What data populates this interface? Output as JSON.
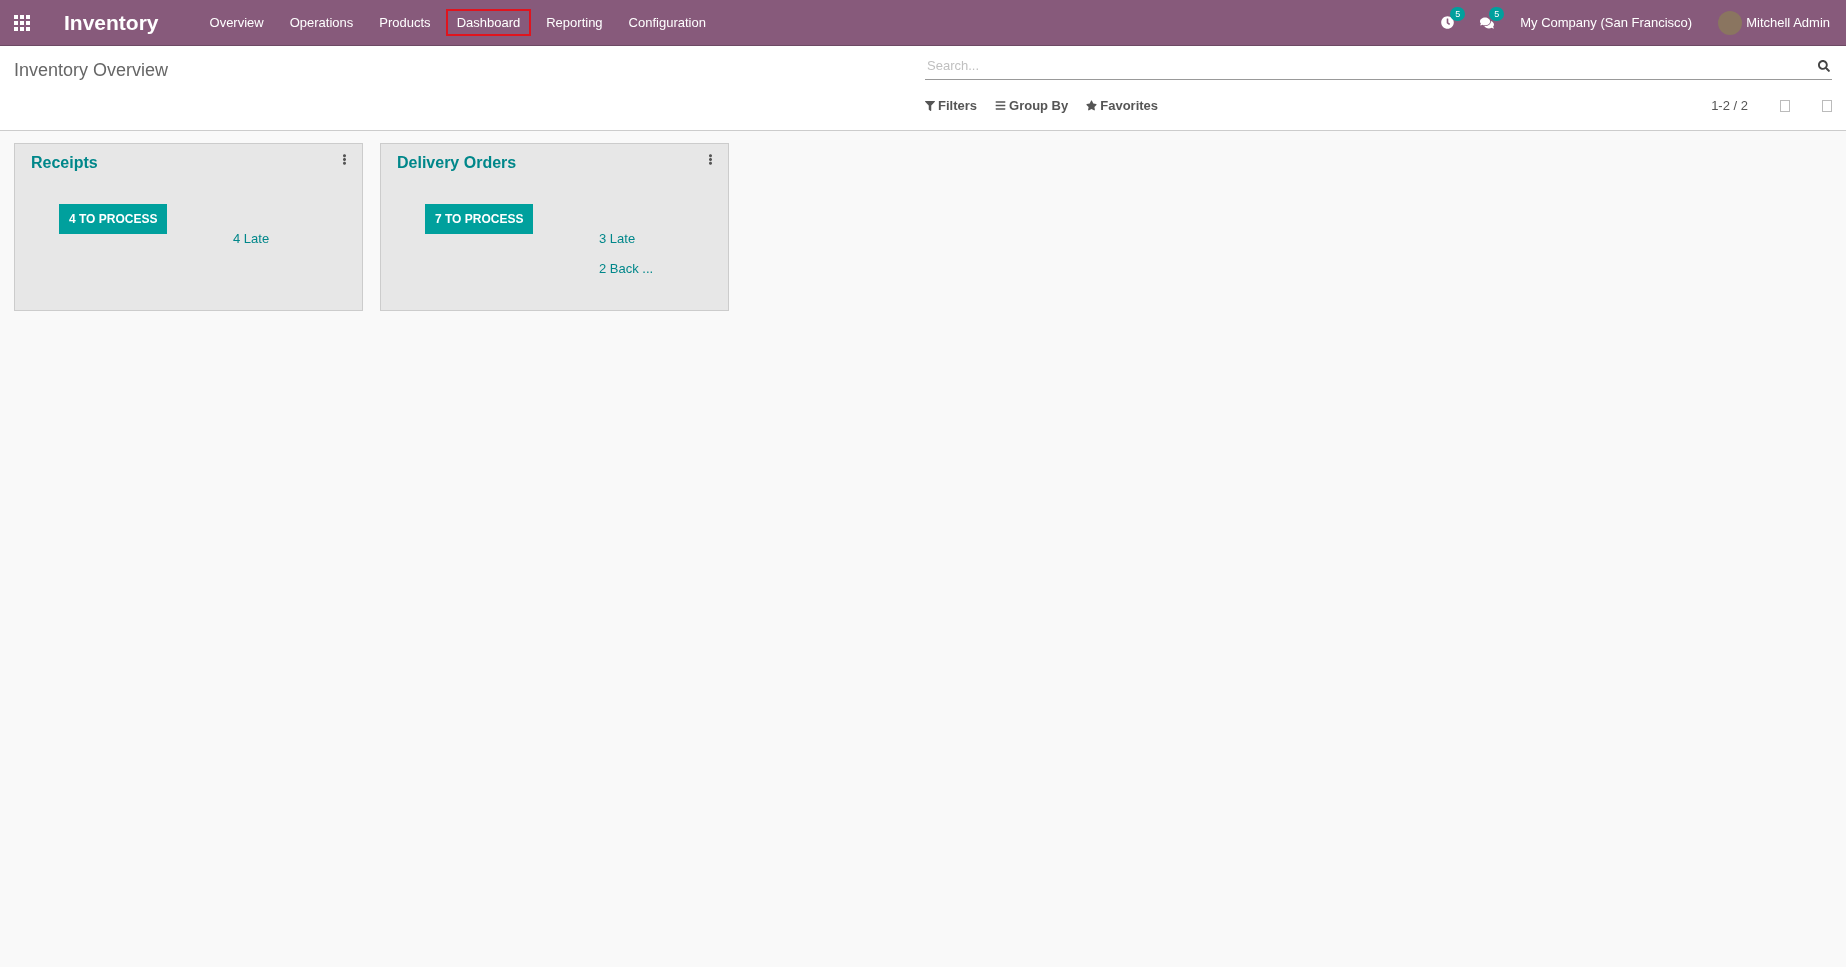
{
  "navbar": {
    "app_name": "Inventory",
    "menu": [
      {
        "label": "Overview",
        "highlighted": false
      },
      {
        "label": "Operations",
        "highlighted": false
      },
      {
        "label": "Products",
        "highlighted": false
      },
      {
        "label": "Dashboard",
        "highlighted": true
      },
      {
        "label": "Reporting",
        "highlighted": false
      },
      {
        "label": "Configuration",
        "highlighted": false
      }
    ],
    "activity_count": "5",
    "message_count": "5",
    "company": "My Company (San Francisco)",
    "user": "Mitchell Admin"
  },
  "control_panel": {
    "title": "Inventory Overview",
    "search": {
      "placeholder": "Search..."
    },
    "filters": [
      {
        "kind": "filter",
        "label": "Filters"
      },
      {
        "kind": "group",
        "label": "Group By"
      },
      {
        "kind": "favorite",
        "label": "Favorites"
      }
    ],
    "pager": "1-2 / 2"
  },
  "cards": [
    {
      "title": "Receipts",
      "button": "4 TO PROCESS",
      "links": [
        "4 Late"
      ]
    },
    {
      "title": "Delivery Orders",
      "button": "7 TO PROCESS",
      "links": [
        "3 Late",
        "2 Back ..."
      ]
    }
  ]
}
